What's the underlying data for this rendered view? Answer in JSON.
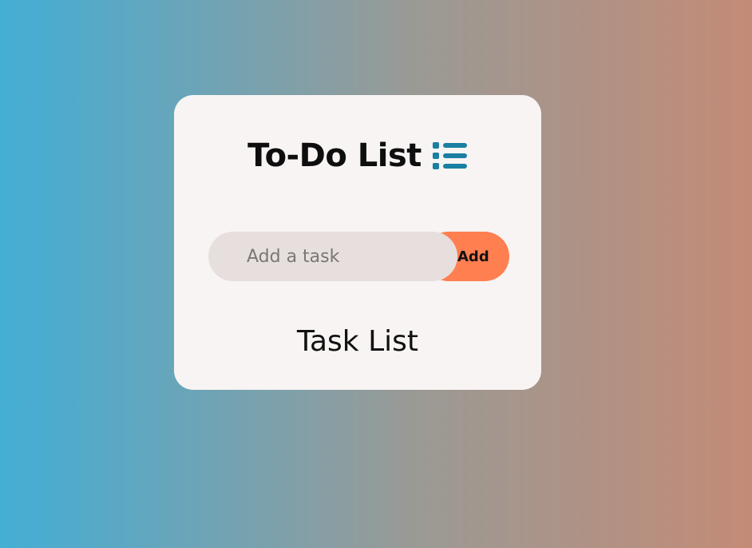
{
  "app": {
    "title": "To-Do List",
    "title_icon": "list-icon"
  },
  "input": {
    "value": "",
    "placeholder": "Add a task"
  },
  "add_button": {
    "label": "Add"
  },
  "task_list": {
    "heading": "Task List",
    "items": []
  },
  "colors": {
    "accent": "#ff7f50",
    "icon": "#1a7fa3",
    "card": "#f8f4f3",
    "input_bg": "#e7dfdd",
    "gradient_left": "#45aed3",
    "gradient_right": "#c38b77"
  }
}
